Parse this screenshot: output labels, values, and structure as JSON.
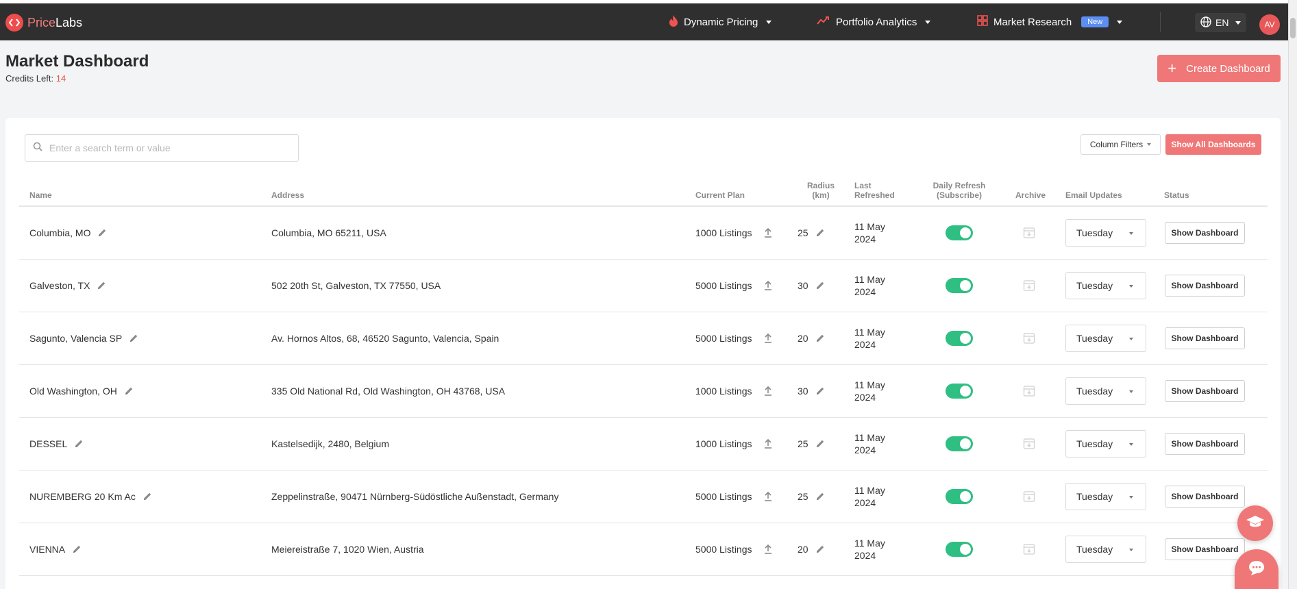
{
  "nav": {
    "logo_price": "Price",
    "logo_labs": "Labs",
    "items": [
      {
        "label": "Dynamic Pricing"
      },
      {
        "label": "Portfolio Analytics"
      },
      {
        "label": "Market Research",
        "badge": "New"
      }
    ],
    "language": "EN",
    "avatar": "AV"
  },
  "header": {
    "title": "Market Dashboard",
    "credits_label": "Credits Left:",
    "credits_value": "14",
    "create_label": "Create Dashboard"
  },
  "toolbar": {
    "search_placeholder": "Enter a search term or value",
    "filters_label": "Column Filters",
    "show_all_label": "Show All Dashboards"
  },
  "table": {
    "headers": {
      "name": "Name",
      "address": "Address",
      "plan": "Current Plan",
      "radius": "Radius\n(km)",
      "refreshed": "Last\nRefreshed",
      "daily": "Daily Refresh\n(Subscribe)",
      "archive": "Archive",
      "email": "Email Updates",
      "status": "Status"
    },
    "rows": [
      {
        "name": "Columbia, MO",
        "address": "Columbia, MO 65211, USA",
        "plan": "1000 Listings",
        "radius": "25",
        "refreshed": "11 May\n2024",
        "email": "Tuesday",
        "status": "Show Dashboard"
      },
      {
        "name": "Galveston, TX",
        "address": "502 20th St, Galveston, TX 77550, USA",
        "plan": "5000 Listings",
        "radius": "30",
        "refreshed": "11 May\n2024",
        "email": "Tuesday",
        "status": "Show Dashboard"
      },
      {
        "name": "Sagunto, Valencia SP",
        "address": "Av. Hornos Altos, 68, 46520 Sagunto, Valencia, Spain",
        "plan": "5000 Listings",
        "radius": "20",
        "refreshed": "11 May\n2024",
        "email": "Tuesday",
        "status": "Show Dashboard"
      },
      {
        "name": "Old Washington, OH",
        "address": "335 Old National Rd, Old Washington, OH 43768, USA",
        "plan": "1000 Listings",
        "radius": "30",
        "refreshed": "11 May\n2024",
        "email": "Tuesday",
        "status": "Show Dashboard"
      },
      {
        "name": "DESSEL",
        "address": "Kastelsedijk, 2480, Belgium",
        "plan": "1000 Listings",
        "radius": "25",
        "refreshed": "11 May\n2024",
        "email": "Tuesday",
        "status": "Show Dashboard"
      },
      {
        "name": "NUREMBERG 20 Km Ac",
        "address": "Zeppelinstraße, 90471 Nürnberg-Südöstliche Außenstadt, Germany",
        "plan": "5000 Listings",
        "radius": "25",
        "refreshed": "11 May\n2024",
        "email": "Tuesday",
        "status": "Show Dashboard"
      },
      {
        "name": "VIENNA",
        "address": "Meiereistraße 7, 1020 Wien, Austria",
        "plan": "5000 Listings",
        "radius": "20",
        "refreshed": "11 May\n2024",
        "email": "Tuesday",
        "status": "Show Dashboard"
      }
    ]
  },
  "icons": {
    "logo": "pricelabs-logo-icon",
    "dynamic_pricing": "flame-icon",
    "portfolio": "trend-line-icon",
    "market": "grid-icon",
    "language": "globe-icon",
    "edit": "pencil-icon",
    "upgrade": "upload-icon",
    "archive": "archive-box-icon",
    "help": "graduation-cap-icon",
    "chat": "chat-bubble-icon"
  },
  "colors": {
    "brand": "#f07777",
    "nav_bg": "#2f2f2f",
    "toggle_on": "#2fbf83",
    "credits": "#e05a47",
    "badge": "#5b8ef0"
  }
}
